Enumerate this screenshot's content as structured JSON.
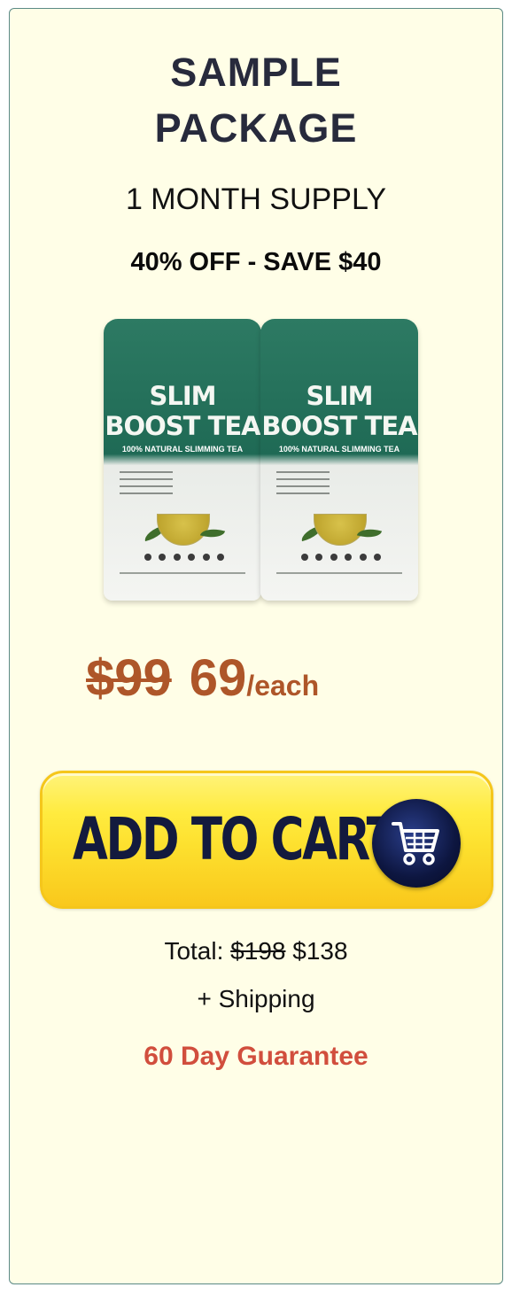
{
  "offer": {
    "title_line1": "SAMPLE",
    "title_line2": "PACKAGE",
    "supply": "1 MONTH SUPPLY",
    "discount": "40% OFF - SAVE $40"
  },
  "product": {
    "name_line1": "SLIM",
    "name_line2": "BOOST TEA",
    "subtitle": "100% NATURAL SLIMMING TEA"
  },
  "price": {
    "old": "$99",
    "new": "69",
    "per": "/each"
  },
  "cta": {
    "label": "ADD TO CART",
    "icon": "shopping-cart-icon"
  },
  "total": {
    "label": "Total:",
    "old": "$198",
    "new": "$138"
  },
  "shipping": "+ Shipping",
  "guarantee": "60 Day Guarantee",
  "colors": {
    "card_bg": "#fffee7",
    "price": "#ae5629",
    "guarantee": "#d14e3d",
    "button_yellow": "#ffeb3f",
    "cart_navy": "#0d1640"
  }
}
